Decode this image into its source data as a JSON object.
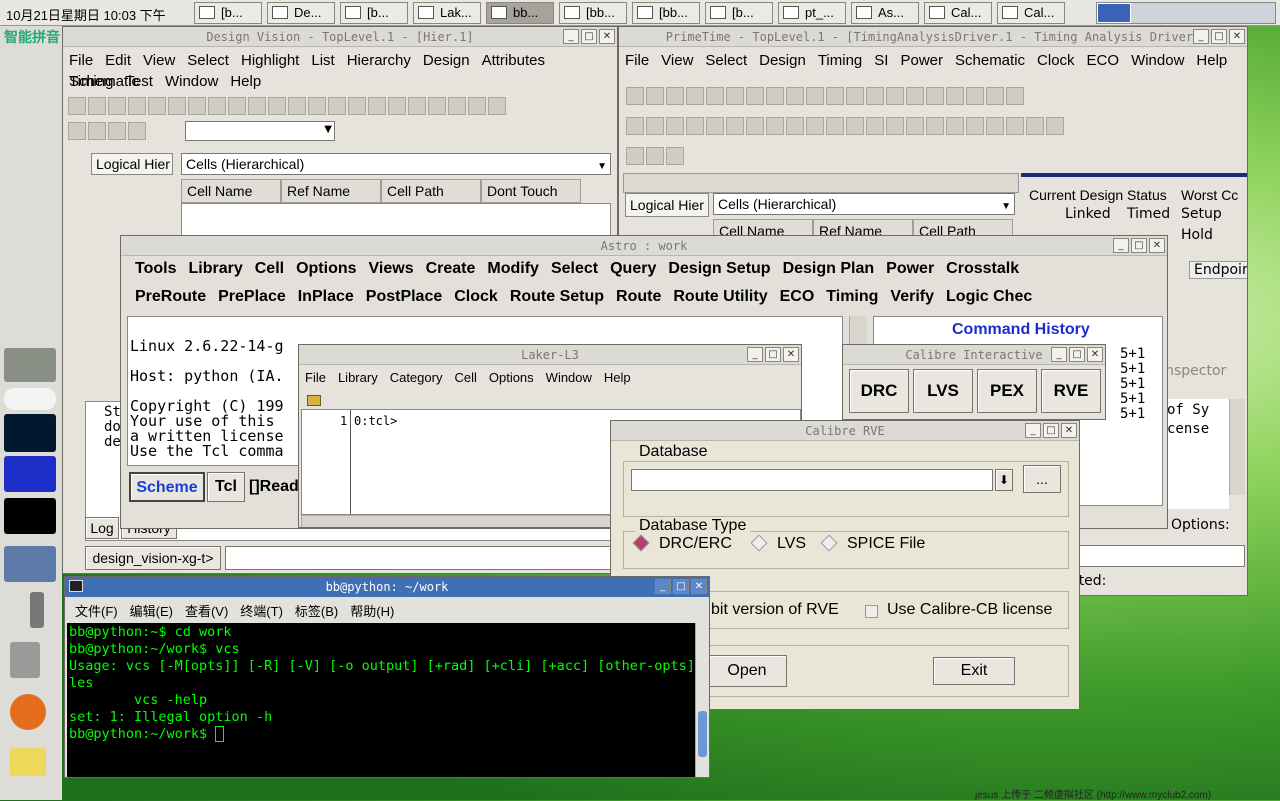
{
  "panel": {
    "clock": "10月21日星期日 10:03 下午",
    "tasks": [
      {
        "label": "[b..."
      },
      {
        "label": "De..."
      },
      {
        "label": "[b..."
      },
      {
        "label": "Lak..."
      },
      {
        "label": "bb..."
      },
      {
        "label": "[bb..."
      },
      {
        "label": "[bb..."
      },
      {
        "label": "[b..."
      },
      {
        "label": "pt_..."
      },
      {
        "label": "As..."
      },
      {
        "label": "Cal..."
      },
      {
        "label": "Cal..."
      }
    ],
    "ime": "智能拼音"
  },
  "dv": {
    "title": "Design Vision - TopLevel.1 - [Hier.1]",
    "menu1": [
      "File",
      "Edit",
      "View",
      "Select",
      "Highlight",
      "List",
      "Hierarchy",
      "Design",
      "Attributes",
      "Schematic"
    ],
    "menu2": [
      "Timing",
      "Test",
      "Window",
      "Help"
    ],
    "tab_logical": "Logical Hier",
    "cells_select": "Cells (Hierarchical)",
    "columns": [
      "Cell Name",
      "Ref Name",
      "Cell Path",
      "Dont Touch"
    ],
    "tabs": [
      "Log",
      "History"
    ],
    "cmd_label": "design_vision-xg-t>",
    "console": [
      "St",
      "do",
      "de"
    ]
  },
  "pt": {
    "title": "PrimeTime - TopLevel.1 - [TimingAnalysisDriver.1 - Timing Analysis Driver]",
    "menu": [
      "File",
      "View",
      "Select",
      "Design",
      "Timing",
      "SI",
      "Power",
      "Schematic",
      "Clock",
      "ECO",
      "Window",
      "Help"
    ],
    "tab_logical": "Logical Hier",
    "cells_select": "Cells (Hierarchical)",
    "columns": [
      "Cell Name",
      "Ref Name",
      "Cell Path"
    ],
    "status_title": "Current Design Status",
    "worst_title": "Worst Cc",
    "linked": "Linked",
    "timed": "Timed",
    "setup": "Setup",
    "hold": "Hold",
    "endpoint": "Endpoin",
    "inspector": "Inspector",
    "options": "Options:",
    "cted": "cted:",
    "right_text": [
      "of Sy",
      "cense"
    ]
  },
  "astro": {
    "title": "Astro : work",
    "menu1": [
      "Tools",
      "Library",
      "Cell",
      "Options",
      "Views",
      "Create",
      "Modify",
      "Select",
      "Query",
      "Design Setup",
      "Design Plan",
      "Power",
      "Crosstalk"
    ],
    "menu2": [
      "PreRoute",
      "PrePlace",
      "InPlace",
      "PostPlace",
      "Clock",
      "Route Setup",
      "Route",
      "Route Utility",
      "ECO",
      "Timing",
      "Verify",
      "Logic Chec"
    ],
    "console": [
      "Linux 2.6.22-14-g",
      "Host: python (IA.",
      "Copyright (C) 199",
      "Your use of this",
      "a written license",
      "Use the Tcl comma"
    ],
    "cmd_history": "Command History",
    "scheme": "Scheme",
    "tcl": "Tcl",
    "ready": "[]Read",
    "history_lines": [
      "5+1",
      "5+1",
      "5+1",
      "5+1",
      "5+1"
    ]
  },
  "laker": {
    "title": "Laker-L3",
    "menu": [
      "File",
      "Library",
      "Category",
      "Cell",
      "Options",
      "Window",
      "Help"
    ],
    "line_no": "1",
    "prompt": "0:tcl>"
  },
  "ci": {
    "title": "Calibre Interactive",
    "buttons": [
      "DRC",
      "LVS",
      "PEX",
      "RVE"
    ]
  },
  "rve": {
    "title": "Calibre RVE",
    "db_label": "Database",
    "db_value": "",
    "browse": "...",
    "type_label": "Database Type",
    "types": [
      "DRC/ERC",
      "LVS",
      "SPICE File"
    ],
    "selected": "DRC/ERC",
    "opt64": "bit version of RVE",
    "opt_cb": "Use Calibre-CB license",
    "open": "Open",
    "exit": "Exit"
  },
  "term": {
    "title": "bb@python: ~/work",
    "menu": [
      "文件(F)",
      "编辑(E)",
      "查看(V)",
      "终端(T)",
      "标签(B)",
      "帮助(H)"
    ],
    "lines": [
      "bb@python:~$ cd work",
      "bb@python:~/work$ vcs",
      "Usage: vcs [-M[opts]] [-R] [-V] [-o output] [+rad] [+cli] [+acc] [other-opts]",
      "les",
      "        vcs -help",
      "set: 1: Illegal option -h",
      "bb@python:~/work$ "
    ],
    "colors": {
      "bg": "#000000",
      "fg": "#00ff00"
    }
  },
  "watermark": "jesus 上传于  二频虚拟社区 (http://www.myclub2.com)"
}
